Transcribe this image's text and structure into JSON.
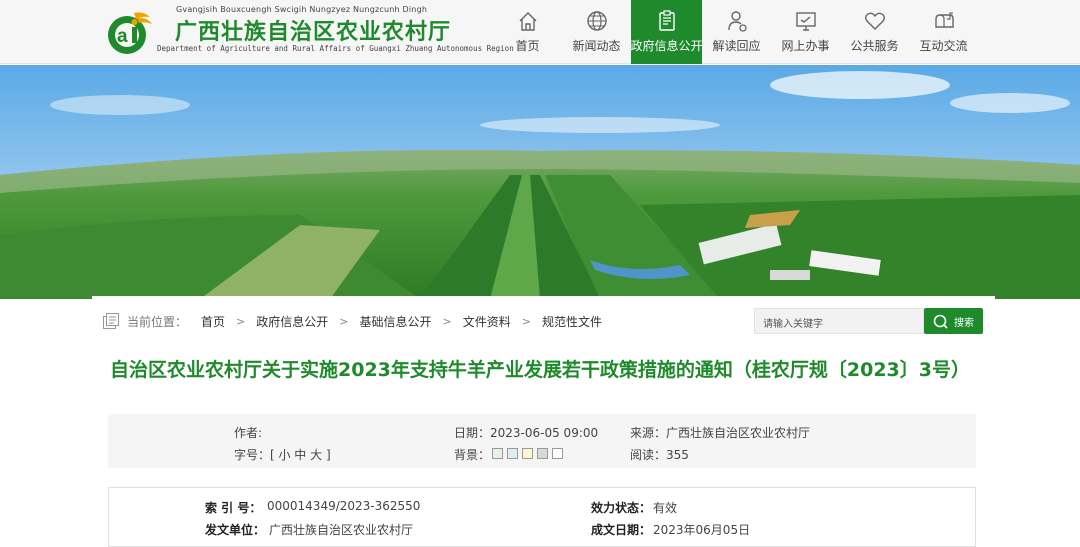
{
  "site": {
    "zhuang_name": "Gvangjsih Bouxcuengh Swcigih Nungzyez Nungzcunh Dingh",
    "title": "广西壮族自治区农业农村厅",
    "english_name": "Department of Agriculture and Rural Affairs of Guangxi Zhuang Autonomous Region",
    "brand_color": "#1f8a2c"
  },
  "nav": {
    "items": [
      {
        "label": "首页",
        "icon": "home-icon"
      },
      {
        "label": "新闻动态",
        "icon": "news-globe-icon"
      },
      {
        "label": "政府信息公开",
        "icon": "document-icon",
        "active": true
      },
      {
        "label": "解读回应",
        "icon": "interpretation-icon"
      },
      {
        "label": "网上办事",
        "icon": "online-service-icon"
      },
      {
        "label": "公共服务",
        "icon": "heart-icon"
      },
      {
        "label": "互动交流",
        "icon": "mailbox-icon"
      }
    ]
  },
  "breadcrumb": {
    "label": "当前位置：",
    "items": [
      "首页",
      "政府信息公开",
      "基础信息公开",
      "文件资料",
      "规范性文件"
    ]
  },
  "search": {
    "placeholder": "请输入关键字",
    "button": "搜索"
  },
  "article": {
    "title": "自治区农业农村厅关于实施2023年支持牛羊产业发展若干政策措施的通知（桂农厅规〔2023〕3号）"
  },
  "meta": {
    "author_label": "作者:",
    "author_value": "",
    "date": "日期：2023-06-05 09:00",
    "source": "来源：广西壮族自治区农业农村厅",
    "font_size": "字号：[ 小 中 大 ]",
    "background_label": "背景：",
    "background_colors": [
      "#e6f4e6",
      "#dfeeee",
      "#fbf7d2",
      "#d9d9d9",
      "#ffffff"
    ],
    "reads": "阅读：355"
  },
  "info": {
    "index_label": "索  引  号：",
    "index_value": "000014349/2023-362550",
    "status_label": "效力状态：",
    "status_value": "有效",
    "issuer_label": "发文单位：",
    "issuer_value": "广西壮族自治区农业农村厅",
    "date_label": "成文日期：",
    "date_value": "2023年06月05日"
  }
}
